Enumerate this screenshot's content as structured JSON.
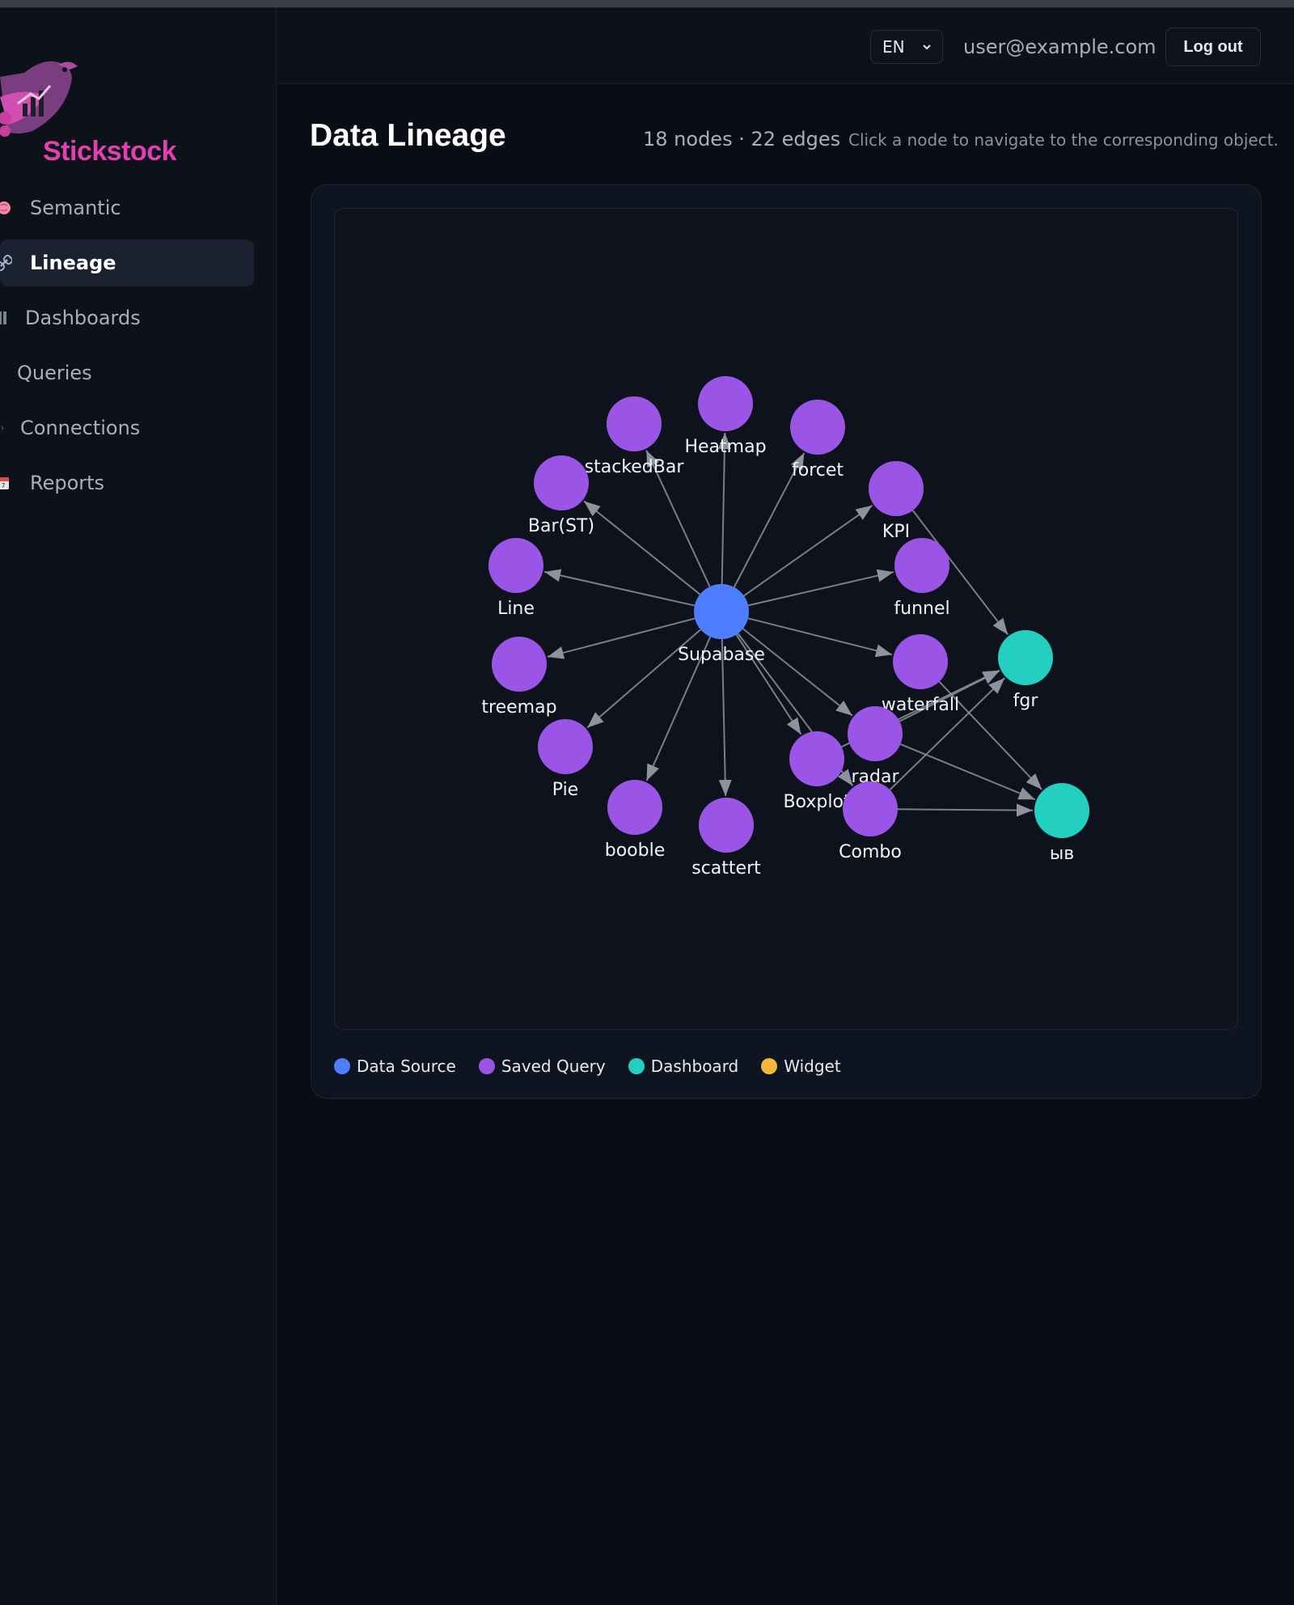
{
  "brand": {
    "name": "Stickstock",
    "accent": "#e23fb0"
  },
  "sidebar": {
    "items": [
      {
        "label": "Semantic",
        "icon": "brain-icon",
        "active": false
      },
      {
        "label": "Lineage",
        "icon": "link-icon",
        "active": true
      },
      {
        "label": "Dashboards",
        "icon": "grid-icon",
        "active": false
      },
      {
        "label": "Queries",
        "icon": "",
        "active": false
      },
      {
        "label": "Connections",
        "icon": "chevron-right-icon",
        "active": false
      },
      {
        "label": "Reports",
        "icon": "calendar-icon",
        "active": false
      }
    ]
  },
  "header": {
    "language": "EN",
    "user_email": "user@example.com",
    "logout_label": "Log out"
  },
  "main": {
    "title": "Data Lineage",
    "stats": "18 nodes · 22 edges",
    "hint": "Click a node to navigate to the corresponding object."
  },
  "legend": [
    {
      "label": "Data Source",
      "color": "#4f7dff"
    },
    {
      "label": "Saved Query",
      "color": "#9b55e6"
    },
    {
      "label": "Dashboard",
      "color": "#22cfc0"
    },
    {
      "label": "Widget",
      "color": "#f5b73b"
    }
  ],
  "graph": {
    "colors": {
      "source": "#4f7dff",
      "query": "#9b55e6",
      "dashboard": "#22cfc0",
      "edge": "#8d939e"
    },
    "nodes": [
      {
        "id": "supabase",
        "label": "Supabase",
        "kind": "source"
      },
      {
        "id": "heatmap",
        "label": "Heatmap",
        "kind": "query"
      },
      {
        "id": "stackedbar",
        "label": "stackedBar",
        "kind": "query"
      },
      {
        "id": "forcet",
        "label": "forcet",
        "kind": "query"
      },
      {
        "id": "barst",
        "label": "Bar(ST)",
        "kind": "query"
      },
      {
        "id": "kpi",
        "label": "KPI",
        "kind": "query"
      },
      {
        "id": "line",
        "label": "Line",
        "kind": "query"
      },
      {
        "id": "funnel",
        "label": "funnel",
        "kind": "query"
      },
      {
        "id": "treemap",
        "label": "treemap",
        "kind": "query"
      },
      {
        "id": "waterfall",
        "label": "waterfall",
        "kind": "query"
      },
      {
        "id": "pie",
        "label": "Pie",
        "kind": "query"
      },
      {
        "id": "radar",
        "label": "radar",
        "kind": "query"
      },
      {
        "id": "booble",
        "label": "booble",
        "kind": "query"
      },
      {
        "id": "scattert",
        "label": "scattert",
        "kind": "query"
      },
      {
        "id": "boxplot",
        "label": "Boxplot",
        "kind": "query"
      },
      {
        "id": "combo",
        "label": "Combo",
        "kind": "query"
      },
      {
        "id": "fgr",
        "label": "fgr",
        "kind": "dashboard"
      },
      {
        "id": "ybv",
        "label": "ыв",
        "kind": "dashboard"
      }
    ],
    "edges": [
      [
        "supabase",
        "heatmap"
      ],
      [
        "supabase",
        "stackedbar"
      ],
      [
        "supabase",
        "forcet"
      ],
      [
        "supabase",
        "barst"
      ],
      [
        "supabase",
        "kpi"
      ],
      [
        "supabase",
        "line"
      ],
      [
        "supabase",
        "funnel"
      ],
      [
        "supabase",
        "treemap"
      ],
      [
        "supabase",
        "waterfall"
      ],
      [
        "supabase",
        "pie"
      ],
      [
        "supabase",
        "radar"
      ],
      [
        "supabase",
        "booble"
      ],
      [
        "supabase",
        "scattert"
      ],
      [
        "supabase",
        "boxplot"
      ],
      [
        "supabase",
        "combo"
      ],
      [
        "kpi",
        "fgr"
      ],
      [
        "waterfall",
        "ybv"
      ],
      [
        "radar",
        "fgr"
      ],
      [
        "radar",
        "ybv"
      ],
      [
        "combo",
        "fgr"
      ],
      [
        "combo",
        "ybv"
      ],
      [
        "boxplot",
        "fgr"
      ]
    ]
  }
}
